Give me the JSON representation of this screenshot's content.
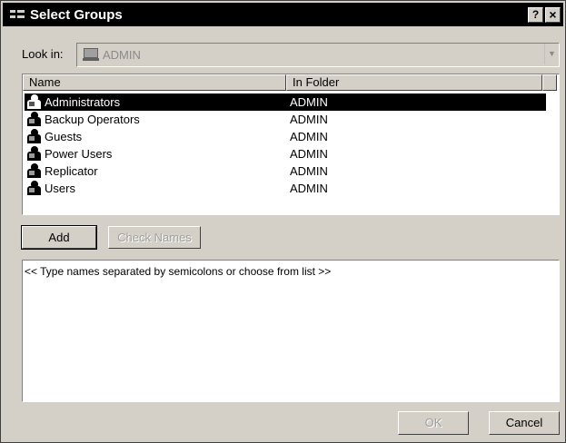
{
  "window": {
    "title": "Select Groups",
    "help_label": "?",
    "close_label": "×"
  },
  "look_in": {
    "label": "Look in:",
    "value": "ADMIN",
    "icon": "computer-icon"
  },
  "list": {
    "columns": [
      "Name",
      "In Folder"
    ],
    "rows": [
      {
        "name": "Administrators",
        "folder": "ADMIN",
        "selected": true,
        "icon": "group-icon"
      },
      {
        "name": "Backup Operators",
        "folder": "ADMIN",
        "selected": false,
        "icon": "group-icon"
      },
      {
        "name": "Guests",
        "folder": "ADMIN",
        "selected": false,
        "icon": "group-icon"
      },
      {
        "name": "Power Users",
        "folder": "ADMIN",
        "selected": false,
        "icon": "group-icon"
      },
      {
        "name": "Replicator",
        "folder": "ADMIN",
        "selected": false,
        "icon": "group-icon"
      },
      {
        "name": "Users",
        "folder": "ADMIN",
        "selected": false,
        "icon": "group-icon"
      }
    ]
  },
  "buttons": {
    "add": "Add",
    "check_names": "Check Names",
    "ok": "OK",
    "cancel": "Cancel"
  },
  "names_box": {
    "placeholder": "<< Type names separated by semicolons or choose from list >>"
  },
  "colors": {
    "dialog_face": "#d4d0c8",
    "titlebar": "#000000",
    "selection": "#000000",
    "disabled_text": "#a0a0a0"
  }
}
